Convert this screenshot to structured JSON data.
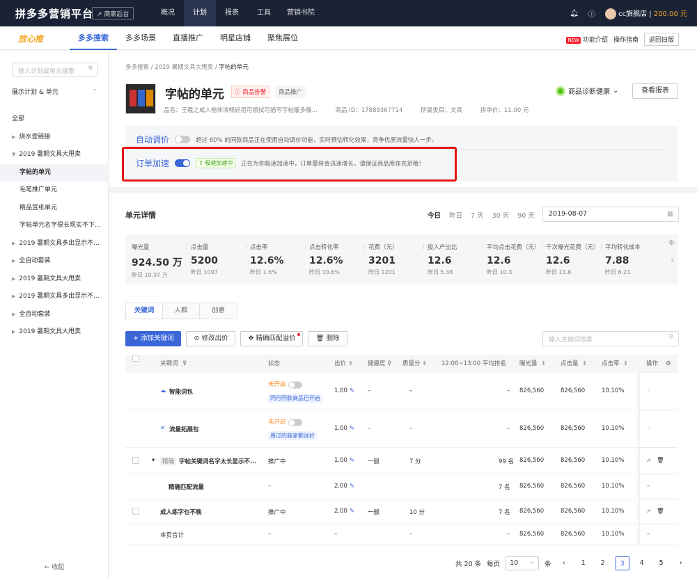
{
  "topbar": {
    "logo": "拼多多营销平台",
    "merchant_btn": "商家后台",
    "nav": [
      "概况",
      "计划",
      "报表",
      "工具",
      "营销书院"
    ],
    "active": "计划",
    "shop": "cc旗舰店",
    "balance": "200.00 元"
  },
  "subnav": {
    "brand": "放心推",
    "tabs": [
      "多多搜索",
      "多多场景",
      "直播推广",
      "明星店铺",
      "聚焦展位"
    ],
    "active": "多多搜索",
    "new_badge": "NEW",
    "intro": "功能介绍",
    "guide": "操作指南",
    "old": "返回旧版"
  },
  "sidebar": {
    "search_placeholder": "输入计划或单元搜索",
    "select": "展示计划 & 单元",
    "tree": [
      {
        "label": "全部",
        "type": "root"
      },
      {
        "label": "烧水壶链接",
        "type": "collapsed"
      },
      {
        "label": "2019 暑期文具大甩卖",
        "type": "expanded"
      },
      {
        "label": "字帖的单元",
        "type": "child-sel"
      },
      {
        "label": "毛笔推广单元",
        "type": "child"
      },
      {
        "label": "精品宣纸单元",
        "type": "child"
      },
      {
        "label": "字帖单元名字很长现实不下...",
        "type": "child"
      },
      {
        "label": "2019 暑期文具多出显示不...",
        "type": "collapsed"
      },
      {
        "label": "全自动套装",
        "type": "collapsed"
      },
      {
        "label": "2019 暑期文具大甩卖",
        "type": "collapsed"
      },
      {
        "label": "2019 暑期文具多出显示不...",
        "type": "collapsed"
      },
      {
        "label": "全自动套装",
        "type": "collapsed"
      },
      {
        "label": "2019 暑期文具大甩卖",
        "type": "collapsed"
      }
    ],
    "collapse": "← 收起"
  },
  "breadcrumb": [
    "多多搜索",
    "2019 暑期文具大甩卖",
    "字帖的单元"
  ],
  "product": {
    "title": "字帖的单元",
    "alarm": "商品告警",
    "promo": "商品推广",
    "name": "品名：王羲之成人楷体流畅好用可擦拭可描写字帖最多展...",
    "id": "商品 ID：17889367714",
    "category": "所属类目：文具",
    "price": "拼单价：11.00 元",
    "health": "商品诊断健康",
    "report": "查看报表"
  },
  "auto_bid": {
    "label": "自动调价",
    "desc": "超过 60% 的同款商品正在使用自动调价功能，实时预估转化效果，竞争优质流量快人一步。"
  },
  "order_boost": {
    "label": "订单加速",
    "badge": "极速加速中",
    "desc": "正在为你极速加速中，订单量将会迅速增长，请保证商品库存充足哦！"
  },
  "details": {
    "title": "单元详情",
    "ranges": [
      "今日",
      "昨日",
      "7 天",
      "30 天",
      "90 天"
    ],
    "date": "2019-08-07"
  },
  "metrics": [
    {
      "label": "曝光量",
      "value": "924.50 万",
      "yest": "昨日 10.97 万"
    },
    {
      "label": "点击量",
      "value": "5200",
      "yest": "昨日 1097"
    },
    {
      "label": "点击率",
      "value": "12.6%",
      "yest": "昨日 1.6%"
    },
    {
      "label": "点击转化率",
      "value": "12.6%",
      "yest": "昨日 10.6%"
    },
    {
      "label": "花费（元）",
      "value": "3201",
      "yest": "昨日 1201"
    },
    {
      "label": "投入产出比",
      "value": "12.6",
      "yest": "昨日 5.38"
    },
    {
      "label": "平均点击花费（元）",
      "value": "12.6",
      "yest": "昨日 10.3"
    },
    {
      "label": "千次曝光花费（元）",
      "value": "12.6",
      "yest": "昨日 11.6"
    },
    {
      "label": "平均转化成本",
      "value": "7.88",
      "yest": "昨日 6.21"
    }
  ],
  "tabs": [
    "关键词",
    "人群",
    "创意"
  ],
  "toolbar": {
    "add": "+ 添加关键词",
    "modify": "修改出价",
    "match": "精确匹配溢价",
    "delete": "删除",
    "search_placeholder": "输入关键词搜索"
  },
  "table": {
    "headers": [
      "关键词",
      "状态",
      "出价",
      "健康度",
      "质量分",
      "12:00~13:00 平均排名",
      "曝光量",
      "点击量",
      "点击率",
      "操作"
    ],
    "rows": [
      {
        "icon": "☁",
        "kw": "智能词包",
        "status": "未开启",
        "tag": "同行同款商品已开启",
        "bid": "1.00",
        "health": "–",
        "quality": "–",
        "rank": "–",
        "exp": "826,560",
        "click": "826,560",
        "ctr": "10.10%",
        "h": 54,
        "chk": false,
        "off": true
      },
      {
        "icon": "✕",
        "kw": "流量拓展包",
        "status": "未开启",
        "tag": "用过的商家都说好",
        "bid": "1.00",
        "health": "–",
        "quality": "–",
        "rank": "–",
        "exp": "826,560",
        "click": "826,560",
        "ctr": "10.10%",
        "h": 54,
        "chk": false,
        "off": true
      },
      {
        "icon": "",
        "kw": "字帖关键词名字太长显示不...",
        "prefix": "精确",
        "status": "推广中",
        "bid": "1.00",
        "health": "一般",
        "quality": "7 分",
        "rank": "99 名",
        "exp": "826,560",
        "click": "826,560",
        "ctr": "10.10%",
        "h": 38,
        "chk": true,
        "expand": true
      },
      {
        "icon": "",
        "kw": "精确匹配流量",
        "status": "–",
        "bid": "2.00",
        "health": "",
        "quality": "",
        "rank": "7 名",
        "exp": "826,560",
        "click": "826,560",
        "ctr": "10.10%",
        "h": 36,
        "sub": true
      },
      {
        "icon": "",
        "kw": "成人练字也不晚",
        "status": "推广中",
        "bid": "2.00",
        "health": "一般",
        "quality": "10 分",
        "rank": "7 名",
        "exp": "826,560",
        "click": "826,560",
        "ctr": "10.10%",
        "h": 36,
        "chk": true
      },
      {
        "icon": "",
        "kw": "本页合计",
        "status": "–",
        "bid": "–",
        "health": "",
        "quality": "–",
        "rank": "–",
        "exp": "826,560",
        "click": "826,560",
        "ctr": "10.10%",
        "h": 30,
        "total": true
      }
    ]
  },
  "pager": {
    "total": "共 20 条",
    "per": "每页",
    "size": "10",
    "unit": "条",
    "pages": [
      "1",
      "2",
      "3",
      "4",
      "5"
    ],
    "current": "3"
  }
}
